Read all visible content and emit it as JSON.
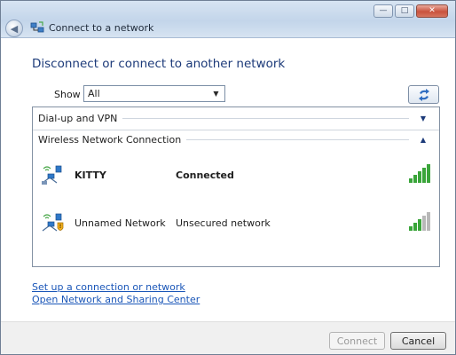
{
  "window": {
    "title": "Connect to a network",
    "controls": {
      "minimize": "—",
      "maximize": "□",
      "close": "✕"
    }
  },
  "nav": {
    "back_icon": "back-arrow-icon",
    "back_glyph": "◀"
  },
  "heading": "Disconnect or connect to another network",
  "filter": {
    "label": "Show",
    "selected": "All"
  },
  "refresh_icon": "refresh-icon",
  "groups": [
    {
      "label": "Dial-up and VPN",
      "expanded": false,
      "chevron": "▼"
    },
    {
      "label": "Wireless Network Connection",
      "expanded": true,
      "chevron": "▲"
    }
  ],
  "networks": [
    {
      "name": "KITTY",
      "status": "Connected",
      "secured": true,
      "signal_bars": 5,
      "signal_of": 5,
      "icon": "wireless-network-icon"
    },
    {
      "name": "Unnamed Network",
      "status": "Unsecured network",
      "secured": false,
      "signal_bars": 3,
      "signal_of": 5,
      "icon": "unsecured-wireless-network-icon"
    }
  ],
  "links": {
    "setup": "Set up a connection or network",
    "sharing_center": "Open Network and Sharing Center"
  },
  "buttons": {
    "connect": "Connect",
    "cancel": "Cancel"
  },
  "colors": {
    "heading": "#1c3a79",
    "link": "#1a56b8",
    "signal_active": "#3aa53a",
    "signal_inactive": "#b8b8b8"
  }
}
